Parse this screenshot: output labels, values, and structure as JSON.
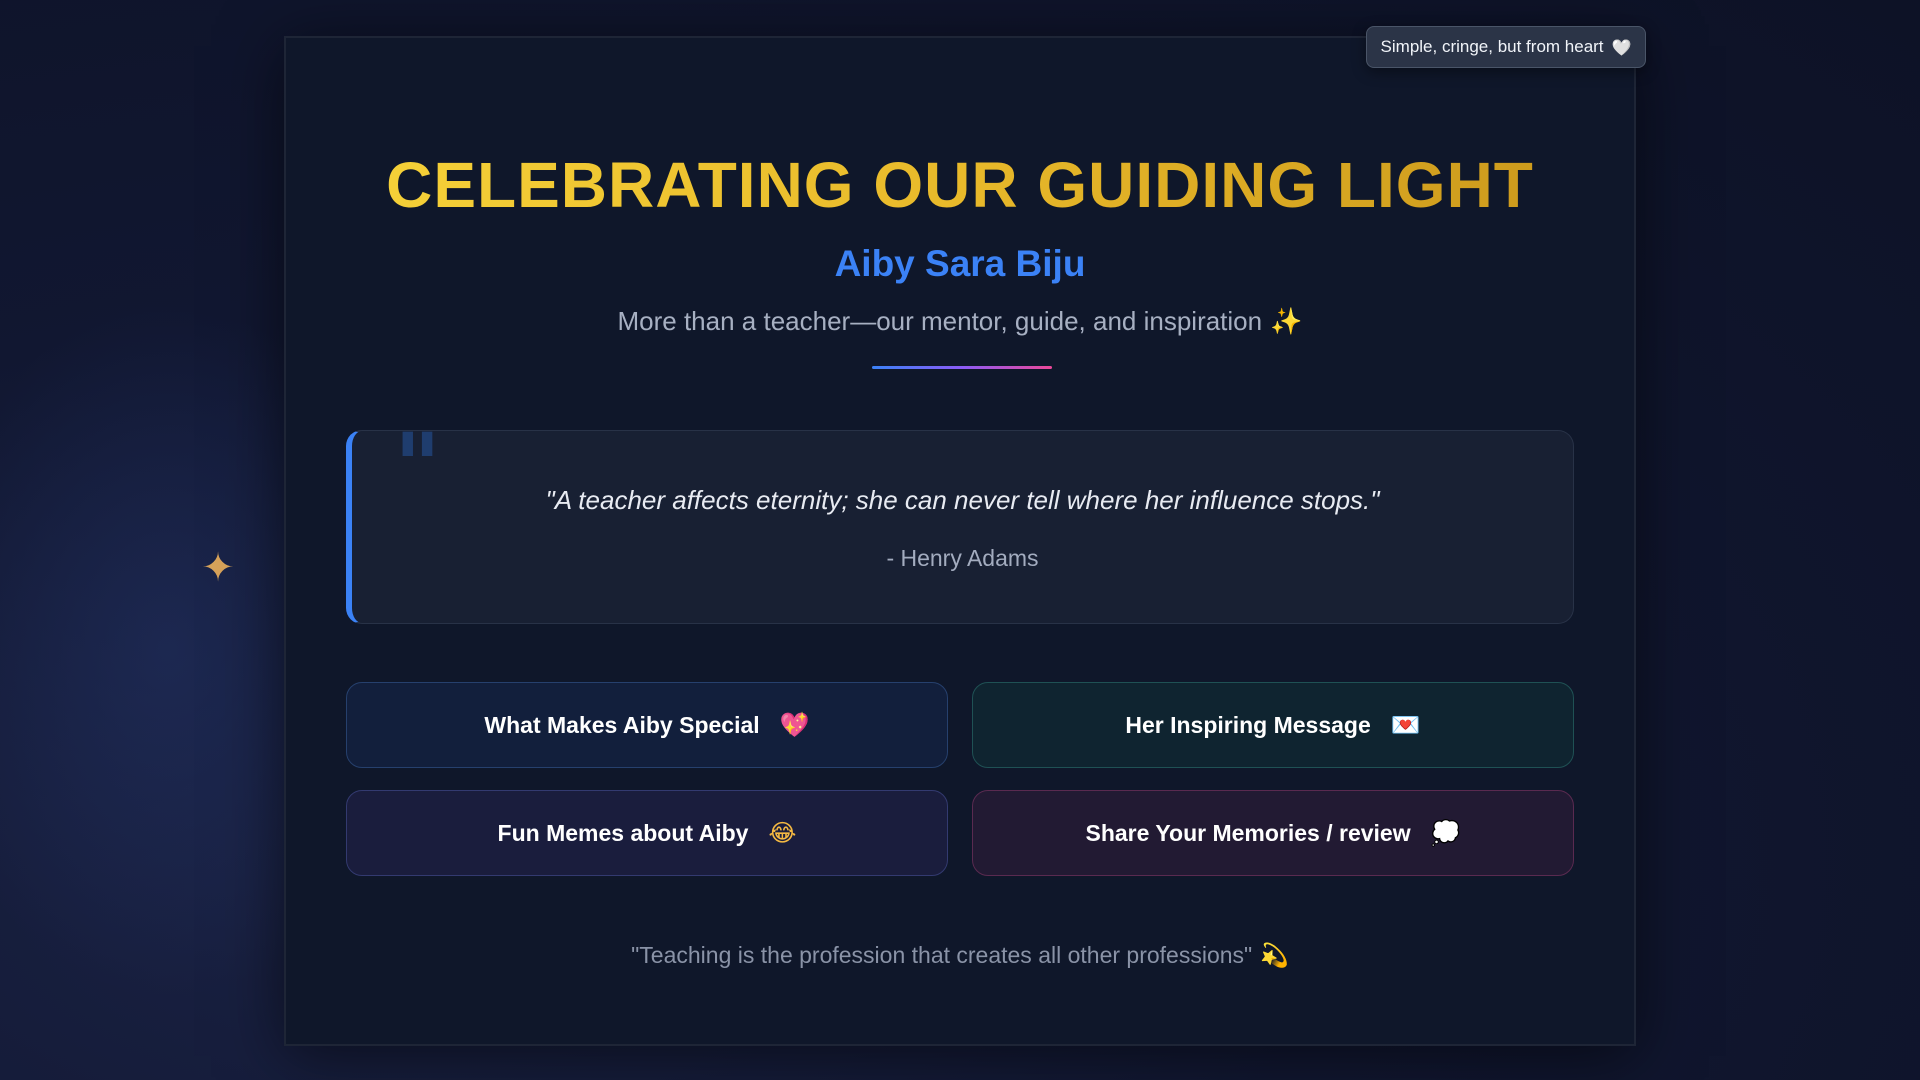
{
  "badge": {
    "text": "Simple, cringe, but from heart",
    "icon": "🤍"
  },
  "header": {
    "title": "CELEBRATING OUR GUIDING LIGHT",
    "name": "Aiby Sara Biju",
    "subtitle": "More than a teacher—our mentor, guide, and inspiration",
    "subtitle_icon": "✨"
  },
  "quote": {
    "mark": "\"",
    "text": "\"A teacher affects eternity; she can never tell where her influence stops.\"",
    "author": "- Henry Adams"
  },
  "buttons": [
    {
      "label": "What Makes Aiby Special",
      "icon": "💖"
    },
    {
      "label": "Her Inspiring Message",
      "icon": "💌"
    },
    {
      "label": "Fun Memes about Aiby",
      "icon": "😂"
    },
    {
      "label": "Share Your Memories / review",
      "icon": "💭"
    }
  ],
  "footer": {
    "text": "\"Teaching is the profession that creates all other professions\"",
    "icon": "💫"
  },
  "decor": {
    "sparkle": "✦"
  },
  "colors": {
    "accent": "#3b82f6",
    "title_gold": "#e8b92a",
    "background": "#0f172a"
  }
}
